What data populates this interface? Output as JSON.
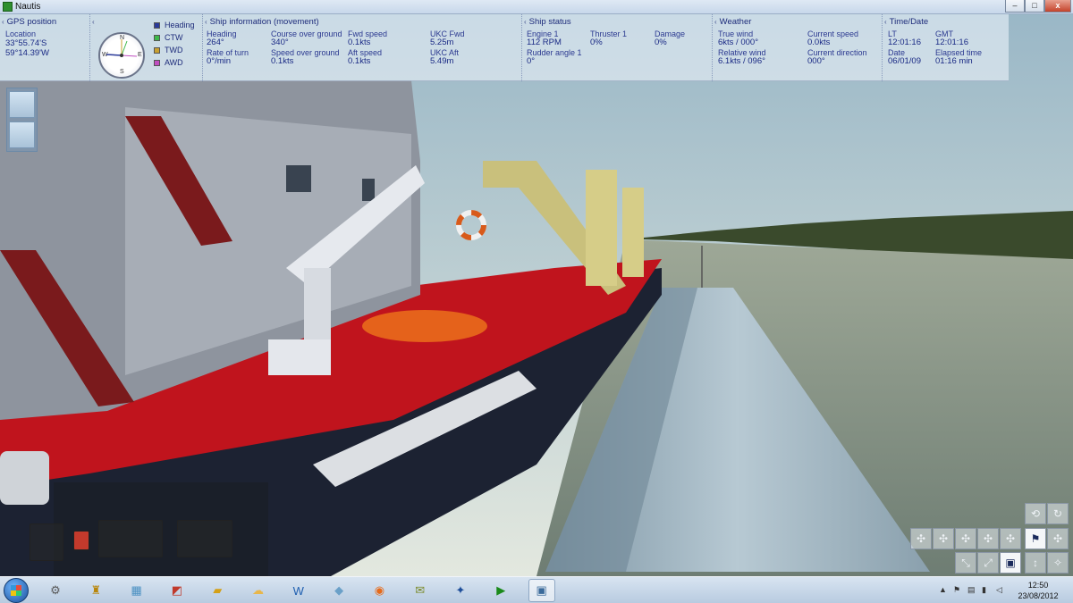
{
  "window": {
    "title": "Nautis",
    "buttons": {
      "minimize": "–",
      "maximize": "□",
      "close": "x"
    }
  },
  "gps": {
    "section_title": "GPS position",
    "location_label": "Location",
    "latitude": "33°55.74'S",
    "longitude": "59°14.39'W"
  },
  "compass": {
    "labels": [
      "N",
      "E",
      "S",
      "W"
    ]
  },
  "legend": [
    {
      "label": "Heading",
      "color": "#2a3a9a"
    },
    {
      "label": "CTW",
      "color": "#3fb94a"
    },
    {
      "label": "TWD",
      "color": "#c8a030"
    },
    {
      "label": "AWD",
      "color": "#c04fc0"
    }
  ],
  "ship_movement": {
    "section_title": "Ship information (movement)",
    "heading_label": "Heading",
    "heading": "264°",
    "rate_of_turn_label": "Rate of turn",
    "rate_of_turn": "0°/min",
    "cog_label": "Course over ground",
    "cog": "340°",
    "sog_label": "Speed over ground",
    "sog": "0.1kts",
    "fwd_speed_label": "Fwd speed",
    "fwd_speed": "0.1kts",
    "aft_speed_label": "Aft speed",
    "aft_speed": "0.1kts",
    "ukc_fwd_label": "UKC Fwd",
    "ukc_fwd": "5.25m",
    "ukc_aft_label": "UKC Aft",
    "ukc_aft": "5.49m"
  },
  "ship_status": {
    "section_title": "Ship status",
    "engine_label": "Engine 1",
    "engine": "112 RPM",
    "thruster_label": "Thruster 1",
    "thruster": "0%",
    "damage_label": "Damage",
    "damage": "0%",
    "rudder_label": "Rudder angle 1",
    "rudder": "0°"
  },
  "weather": {
    "section_title": "Weather",
    "true_wind_label": "True wind",
    "true_wind": "6kts / 000°",
    "relative_wind_label": "Relative wind",
    "relative_wind": "6.1kts / 096°",
    "current_speed_label": "Current speed",
    "current_speed": "0.0kts",
    "current_direction_label": "Current direction",
    "current_direction": "000°"
  },
  "time": {
    "section_title": "Time/Date",
    "lt_label": "LT",
    "lt": "12:01:16",
    "gmt_label": "GMT",
    "gmt": "12:01:16",
    "date_label": "Date",
    "date": "06/01/09",
    "elapsed_label": "Elapsed time",
    "elapsed": "01:16 min"
  },
  "taskbar": {
    "apps": [
      {
        "name": "settings",
        "glyph": "⚙"
      },
      {
        "name": "game",
        "glyph": "♜"
      },
      {
        "name": "calculator",
        "glyph": "▦"
      },
      {
        "name": "chart",
        "glyph": "◩"
      },
      {
        "name": "folder",
        "glyph": "▰"
      },
      {
        "name": "weather",
        "glyph": "☁"
      },
      {
        "name": "word",
        "glyph": "W"
      },
      {
        "name": "media",
        "glyph": "◆"
      },
      {
        "name": "firefox",
        "glyph": "◉"
      },
      {
        "name": "chat",
        "glyph": "✉"
      },
      {
        "name": "thunderbird",
        "glyph": "✦"
      },
      {
        "name": "player",
        "glyph": "▶"
      },
      {
        "name": "nautis",
        "glyph": "▣"
      }
    ],
    "clock_time": "12:50",
    "clock_date": "23/08/2012"
  }
}
